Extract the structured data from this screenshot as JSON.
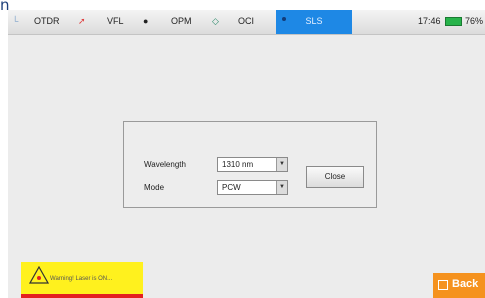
{
  "top_fragment": "n",
  "tabs": [
    {
      "name": "otdr",
      "label": "OTDR",
      "icon": "graph-icon"
    },
    {
      "name": "vfl",
      "label": "VFL",
      "icon": "laser-pointer-icon"
    },
    {
      "name": "opm",
      "label": "OPM",
      "icon": "power-meter-icon"
    },
    {
      "name": "oci",
      "label": "OCI",
      "icon": "connector-icon"
    },
    {
      "name": "sls",
      "label": "SLS",
      "icon": "light-source-icon",
      "active": true
    }
  ],
  "status": {
    "time": "17:46",
    "battery": "76%",
    "battery_color": "#27b34a"
  },
  "dialog": {
    "wavelength_label": "Wavelength",
    "wavelength_value": "1310 nm",
    "mode_label": "Mode",
    "mode_value": "PCW",
    "close_label": "Close"
  },
  "warning": {
    "text": "Warning! Laser is ON..."
  },
  "back": {
    "label": "Back"
  },
  "colors": {
    "active_tab": "#1e88e5",
    "warning_bg": "#fff11e",
    "warning_bar": "#e32020",
    "back_btn": "#f5921e"
  }
}
